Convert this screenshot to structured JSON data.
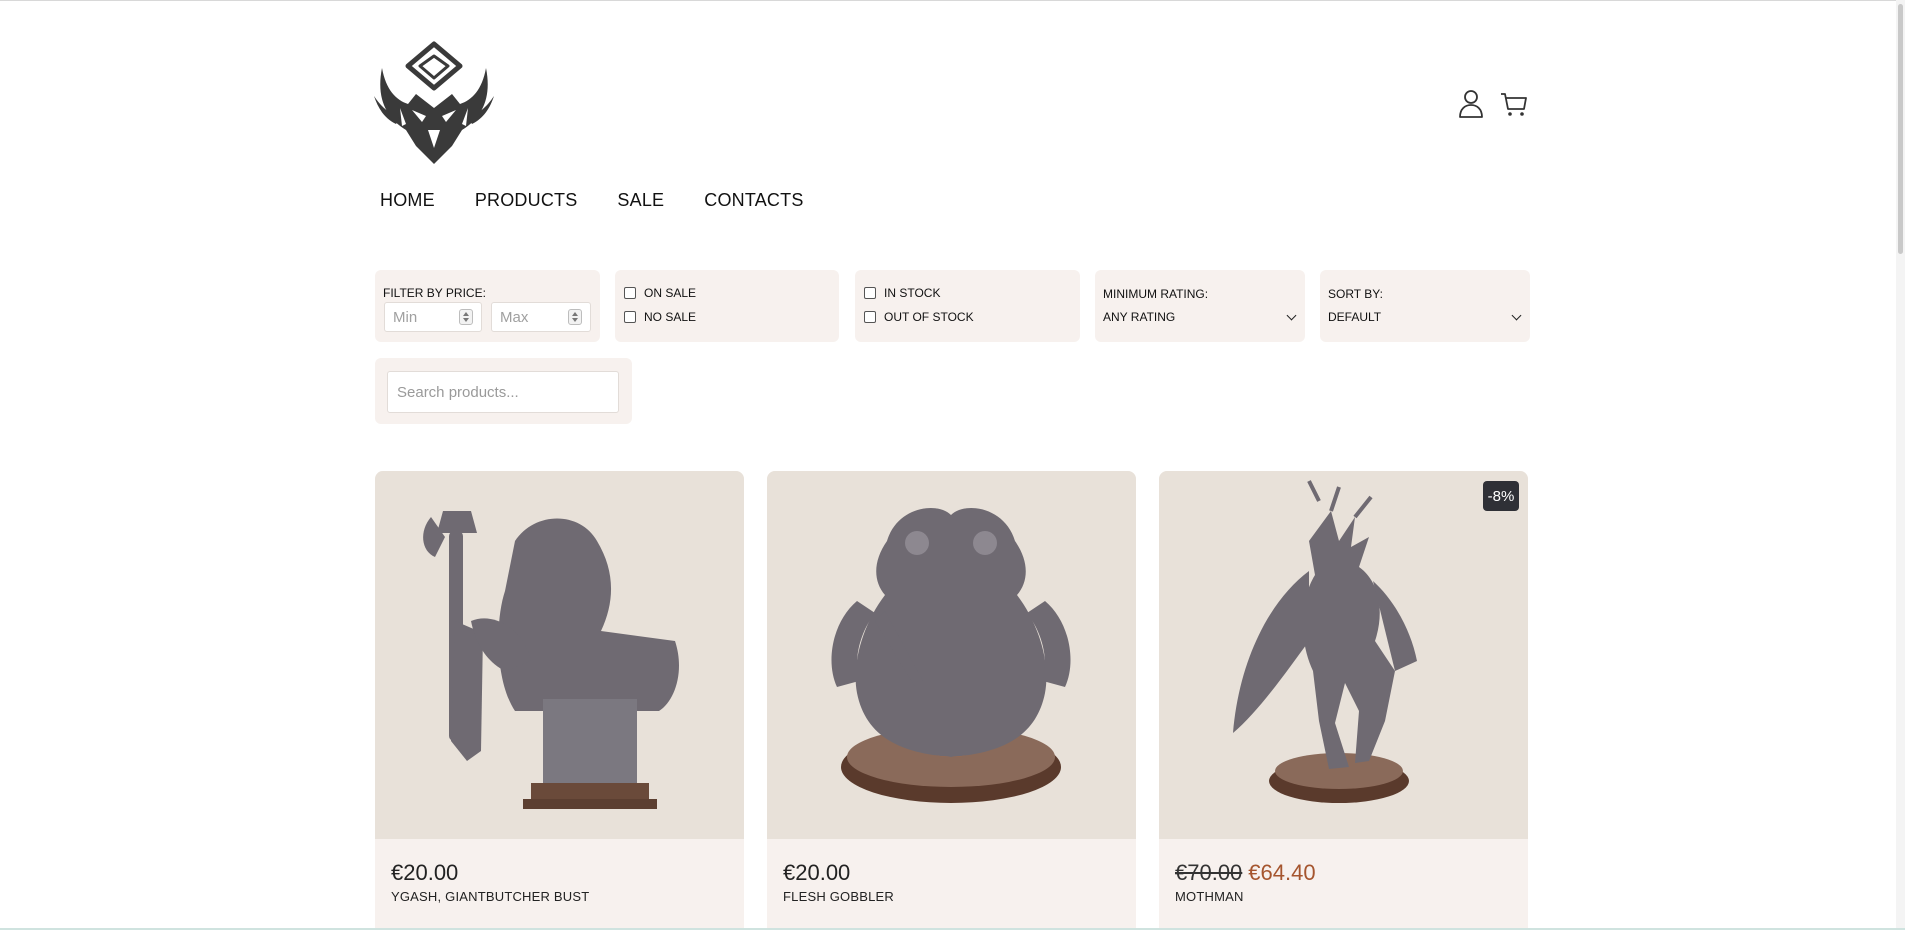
{
  "header": {
    "logo": "brand-logo",
    "icons": [
      "user-icon",
      "cart-icon"
    ]
  },
  "nav": {
    "items": [
      {
        "label": "HOME"
      },
      {
        "label": "PRODUCTS"
      },
      {
        "label": "SALE"
      },
      {
        "label": "CONTACTS"
      }
    ]
  },
  "filters": {
    "price_label": "FILTER BY PRICE:",
    "min_placeholder": "Min",
    "max_placeholder": "Max",
    "on_sale": "ON SALE",
    "no_sale": "NO SALE",
    "in_stock": "IN STOCK",
    "out_of_stock": "OUT OF STOCK",
    "rating_label": "MINIMUM RATING:",
    "rating_value": "ANY RATING",
    "sort_label": "SORT BY:",
    "sort_value": "DEFAULT"
  },
  "search": {
    "placeholder": "Search products..."
  },
  "products": [
    {
      "price": "€20.00",
      "name": "YGASH, GIANTBUTCHER BUST"
    },
    {
      "price": "€20.00",
      "name": "FLESH GOBBLER"
    },
    {
      "old_price": "€70.00",
      "price": "€64.40",
      "name": "MOTHMAN",
      "badge": "-8%"
    }
  ],
  "colors": {
    "panel_bg": "#f7f1ee",
    "image_bg": "#e8e1d9",
    "sale_price": "#a5552e",
    "badge_bg": "#2f3036"
  }
}
